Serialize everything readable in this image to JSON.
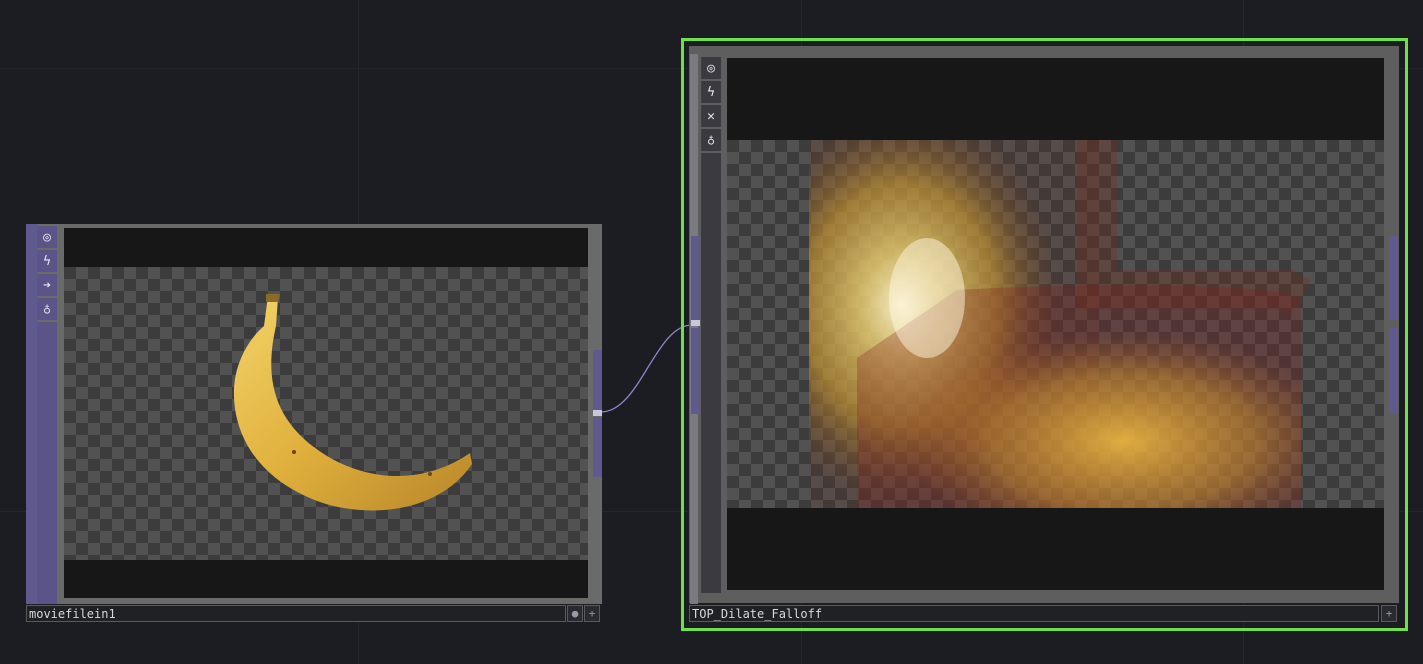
{
  "nodes": {
    "moviefilein": {
      "name": "moviefilein1",
      "flags": [
        "viewer-icon",
        "bypass-icon",
        "arrow-right-icon",
        "lock-icon"
      ]
    },
    "dilate": {
      "name": "TOP_Dilate_Falloff",
      "flags": [
        "viewer-icon",
        "bypass-icon",
        "close-icon",
        "lock-icon"
      ],
      "selected_color": "#6fe04a"
    }
  },
  "colors": {
    "background": "#1c1d22",
    "node_accent": "#5e5a8e",
    "wire": "#8a86c8"
  }
}
